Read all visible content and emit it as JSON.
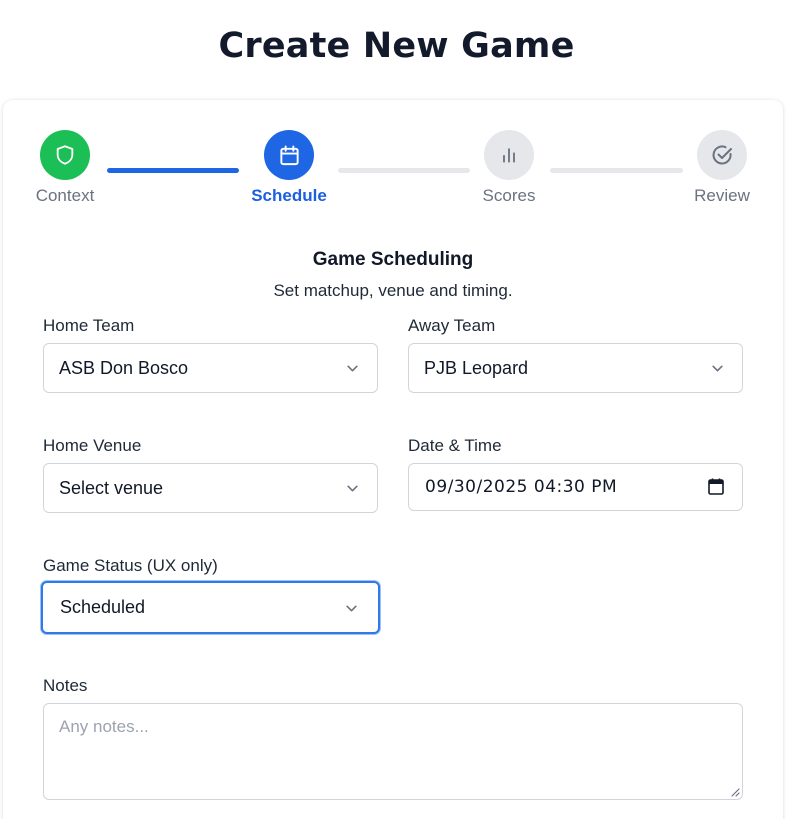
{
  "page": {
    "title": "Create New Game"
  },
  "stepper": {
    "steps": [
      {
        "label": "Context",
        "icon": "shield-icon",
        "state": "done"
      },
      {
        "label": "Schedule",
        "icon": "calendar-icon",
        "state": "current"
      },
      {
        "label": "Scores",
        "icon": "bar-chart-icon",
        "state": "pending"
      },
      {
        "label": "Review",
        "icon": "check-circle-icon",
        "state": "pending"
      }
    ]
  },
  "section": {
    "heading": "Game Scheduling",
    "subheading": "Set matchup, venue and timing."
  },
  "form": {
    "home_team": {
      "label": "Home Team",
      "value": "ASB Don Bosco"
    },
    "away_team": {
      "label": "Away Team",
      "value": "PJB Leopard"
    },
    "home_venue": {
      "label": "Home Venue",
      "value": "Select venue"
    },
    "date_time": {
      "label": "Date & Time",
      "value": "09/30/2025 04:30 PM"
    },
    "game_status": {
      "label": "Game Status (UX only)",
      "value": "Scheduled"
    },
    "notes": {
      "label": "Notes",
      "placeholder": "Any notes..."
    }
  },
  "colors": {
    "done": "#1bbf55",
    "current": "#1f66e5",
    "pending": "#e5e7eb",
    "focus_ring": "#2f7ae5"
  }
}
